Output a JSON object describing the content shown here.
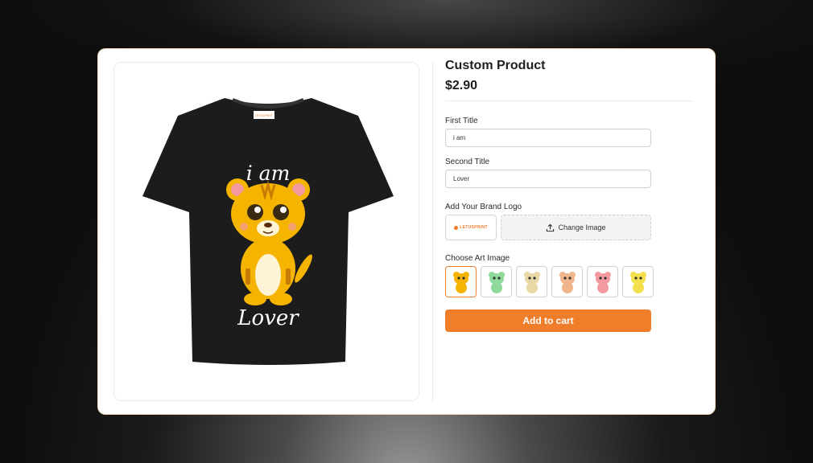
{
  "product": {
    "title": "Custom Product",
    "price": "$2.90",
    "shirt_text_top": "i am",
    "shirt_text_bottom": "Lover",
    "shirt_tag_text": "LETUSPRINT"
  },
  "fields": {
    "first_title_label": "First Title",
    "first_title_value": "i am",
    "second_title_label": "Second Title",
    "second_title_value": "Lover"
  },
  "brand_logo": {
    "label": "Add Your Brand Logo",
    "logo_text": "LETUSPRINT",
    "change_label": "Change Image",
    "change_icon": "upload-icon"
  },
  "art": {
    "label": "Choose Art Image",
    "options": [
      {
        "name": "tiger-orange",
        "color": "#f5b400",
        "selected": true
      },
      {
        "name": "tiger-green",
        "color": "#8fd99a",
        "selected": false
      },
      {
        "name": "tiger-cream",
        "color": "#e9d8a6",
        "selected": false
      },
      {
        "name": "tiger-peach",
        "color": "#f0b58c",
        "selected": false
      },
      {
        "name": "tiger-pink",
        "color": "#f29aa0",
        "selected": false
      },
      {
        "name": "tiger-yellow",
        "color": "#f4e04d",
        "selected": false
      }
    ]
  },
  "cart": {
    "label": "Add to cart"
  },
  "colors": {
    "accent": "#ef7d2a",
    "shirt": "#1c1c1c"
  }
}
